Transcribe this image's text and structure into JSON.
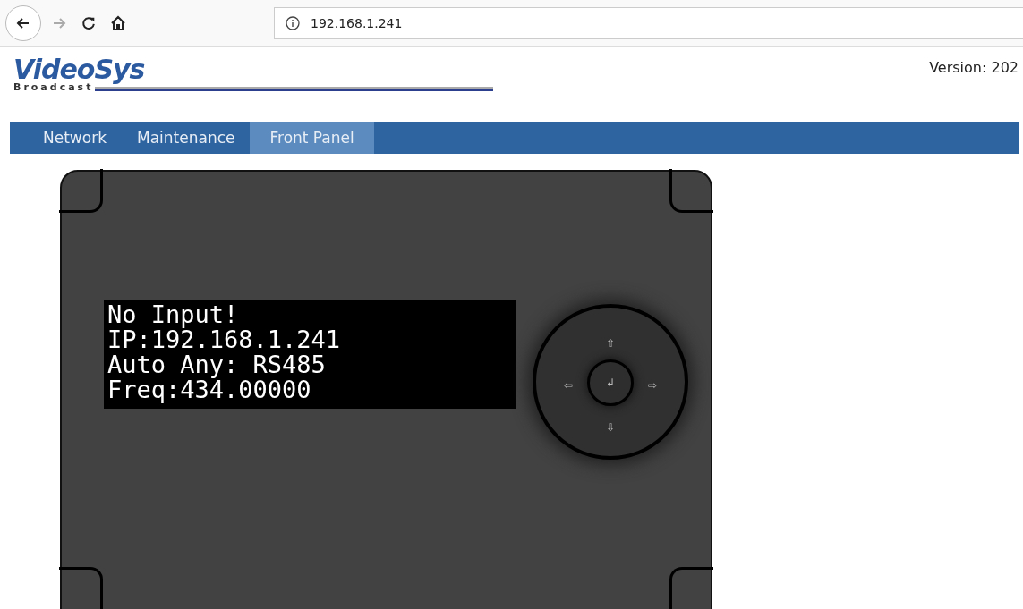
{
  "browser": {
    "url": "192.168.1.241"
  },
  "header": {
    "logo_title": "VideoSys",
    "logo_subtitle": "Broadcast",
    "version": "Version: 202"
  },
  "tabs": [
    {
      "label": "Network",
      "selected": false
    },
    {
      "label": "Maintenance",
      "selected": false
    },
    {
      "label": "Front Panel",
      "selected": true
    }
  ],
  "display": {
    "lines": [
      "No Input!",
      "IP:192.168.1.241",
      "Auto Any: RS485",
      "Freq:434.00000"
    ]
  },
  "dial": {
    "up": "⇧",
    "left": "⇦",
    "enter": "↲",
    "right": "⇨",
    "down": "⇩"
  }
}
